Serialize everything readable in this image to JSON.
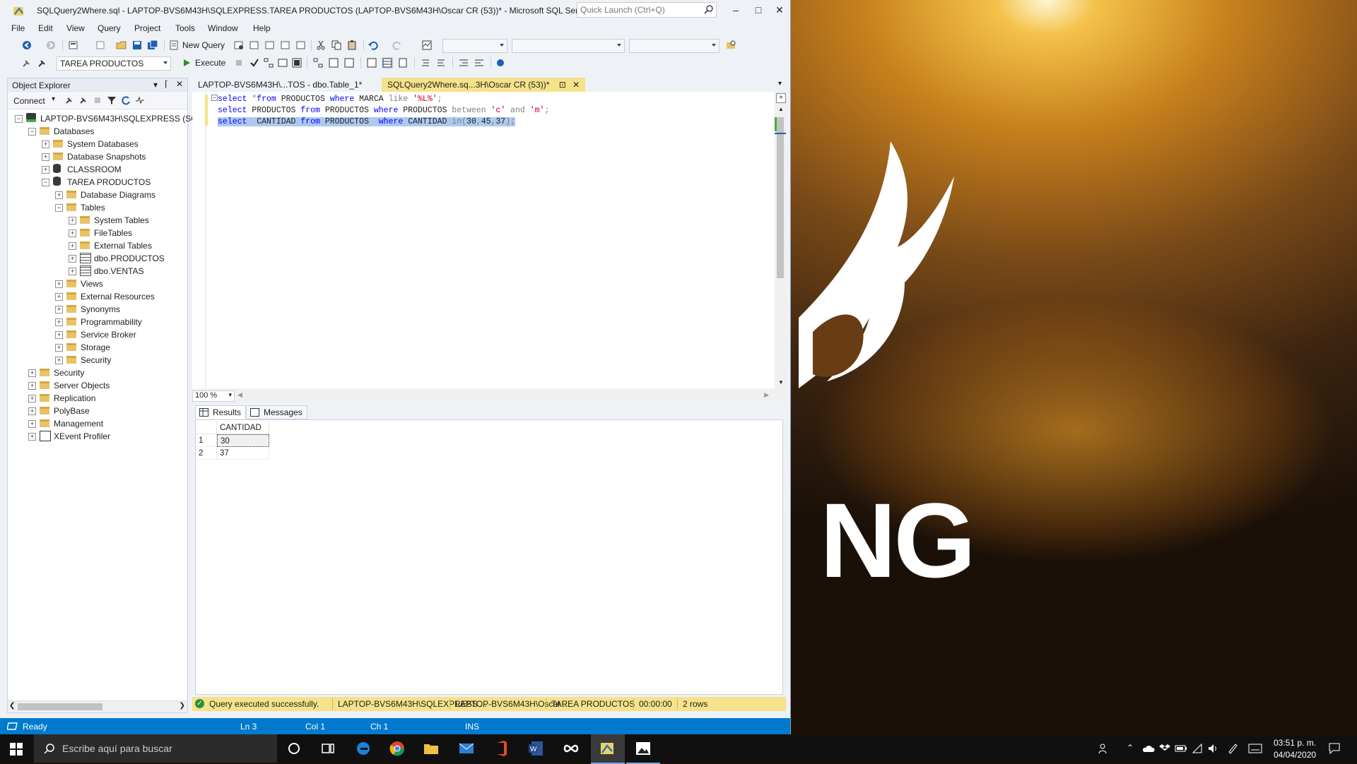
{
  "window": {
    "title": "SQLQuery2Where.sql - LAPTOP-BVS6M43H\\SQLEXPRESS.TAREA PRODUCTOS (LAPTOP-BVS6M43H\\Oscar CR (53))* - Microsoft SQL Server Man...",
    "quick_launch_placeholder": "Quick Launch (Ctrl+Q)"
  },
  "menu": [
    "File",
    "Edit",
    "View",
    "Query",
    "Project",
    "Tools",
    "Window",
    "Help"
  ],
  "toolbar": {
    "new_query": "New Query",
    "database_combo": "TAREA PRODUCTOS",
    "execute": "Execute"
  },
  "object_explorer": {
    "title": "Object Explorer",
    "connect": "Connect",
    "tree": [
      {
        "label": "LAPTOP-BVS6M43H\\SQLEXPRESS (SQL",
        "depth": 0,
        "expanded": true,
        "icon": "server-icon"
      },
      {
        "label": "Databases",
        "depth": 1,
        "expanded": true,
        "icon": "folder-icon"
      },
      {
        "label": "System Databases",
        "depth": 2,
        "expanded": false,
        "icon": "folder-icon"
      },
      {
        "label": "Database Snapshots",
        "depth": 2,
        "expanded": false,
        "icon": "folder-icon"
      },
      {
        "label": "CLASSROOM",
        "depth": 2,
        "expanded": false,
        "icon": "database-icon"
      },
      {
        "label": "TAREA PRODUCTOS",
        "depth": 2,
        "expanded": true,
        "icon": "database-icon"
      },
      {
        "label": "Database Diagrams",
        "depth": 3,
        "expanded": false,
        "icon": "folder-icon"
      },
      {
        "label": "Tables",
        "depth": 3,
        "expanded": true,
        "icon": "folder-icon"
      },
      {
        "label": "System Tables",
        "depth": 4,
        "expanded": false,
        "icon": "folder-icon"
      },
      {
        "label": "FileTables",
        "depth": 4,
        "expanded": false,
        "icon": "folder-icon"
      },
      {
        "label": "External Tables",
        "depth": 4,
        "expanded": false,
        "icon": "folder-icon"
      },
      {
        "label": "dbo.PRODUCTOS",
        "depth": 4,
        "expanded": false,
        "icon": "table-icon"
      },
      {
        "label": "dbo.VENTAS",
        "depth": 4,
        "expanded": false,
        "icon": "table-icon"
      },
      {
        "label": "Views",
        "depth": 3,
        "expanded": false,
        "icon": "folder-icon"
      },
      {
        "label": "External Resources",
        "depth": 3,
        "expanded": false,
        "icon": "folder-icon"
      },
      {
        "label": "Synonyms",
        "depth": 3,
        "expanded": false,
        "icon": "folder-icon"
      },
      {
        "label": "Programmability",
        "depth": 3,
        "expanded": false,
        "icon": "folder-icon"
      },
      {
        "label": "Service Broker",
        "depth": 3,
        "expanded": false,
        "icon": "folder-icon"
      },
      {
        "label": "Storage",
        "depth": 3,
        "expanded": false,
        "icon": "folder-icon"
      },
      {
        "label": "Security",
        "depth": 3,
        "expanded": false,
        "icon": "folder-icon"
      },
      {
        "label": "Security",
        "depth": 1,
        "expanded": false,
        "icon": "folder-icon"
      },
      {
        "label": "Server Objects",
        "depth": 1,
        "expanded": false,
        "icon": "folder-icon"
      },
      {
        "label": "Replication",
        "depth": 1,
        "expanded": false,
        "icon": "folder-icon"
      },
      {
        "label": "PolyBase",
        "depth": 1,
        "expanded": false,
        "icon": "folder-icon"
      },
      {
        "label": "Management",
        "depth": 1,
        "expanded": false,
        "icon": "folder-icon"
      },
      {
        "label": "XEvent Profiler",
        "depth": 1,
        "expanded": false,
        "icon": "profiler-icon"
      }
    ]
  },
  "doc_tabs": [
    {
      "label": "LAPTOP-BVS6M43H\\...TOS - dbo.Table_1*",
      "active": false
    },
    {
      "label": "SQLQuery2Where.sq...3H\\Oscar CR (53))*",
      "active": true
    }
  ],
  "editor": {
    "lines": [
      [
        {
          "t": "select ",
          "c": "kw"
        },
        {
          "t": "*",
          "c": "gr"
        },
        {
          "t": "from ",
          "c": "kw"
        },
        {
          "t": "PRODUCTOS ",
          "c": "idt"
        },
        {
          "t": "where ",
          "c": "kw"
        },
        {
          "t": "MARCA ",
          "c": "idt"
        },
        {
          "t": "like ",
          "c": "gr"
        },
        {
          "t": "'%L%'",
          "c": "str"
        },
        {
          "t": ";",
          "c": "gr"
        }
      ],
      [
        {
          "t": "select ",
          "c": "kw"
        },
        {
          "t": "PRODUCTOS ",
          "c": "idt"
        },
        {
          "t": "from ",
          "c": "kw"
        },
        {
          "t": "PRODUCTOS ",
          "c": "idt"
        },
        {
          "t": "where ",
          "c": "kw"
        },
        {
          "t": "PRODUCTOS ",
          "c": "idt"
        },
        {
          "t": "between ",
          "c": "gr"
        },
        {
          "t": "'c' ",
          "c": "str"
        },
        {
          "t": "and ",
          "c": "gr"
        },
        {
          "t": "'m'",
          "c": "str"
        },
        {
          "t": ";",
          "c": "gr"
        }
      ],
      [
        {
          "t": "select  ",
          "c": "kw"
        },
        {
          "t": "CANTIDAD ",
          "c": "idt"
        },
        {
          "t": "from ",
          "c": "kw"
        },
        {
          "t": "PRODUCTOS  ",
          "c": "idt"
        },
        {
          "t": "where ",
          "c": "kw"
        },
        {
          "t": "CANTIDAD ",
          "c": "idt"
        },
        {
          "t": "in",
          "c": "gr"
        },
        {
          "t": "(",
          "c": "gr"
        },
        {
          "t": "30",
          "c": "idt"
        },
        {
          "t": ",",
          "c": "gr"
        },
        {
          "t": "45",
          "c": "idt"
        },
        {
          "t": ",",
          "c": "gr"
        },
        {
          "t": "37",
          "c": "idt"
        },
        {
          "t": ");",
          "c": "gr"
        }
      ]
    ],
    "selected_line": 2,
    "zoom": "100 %"
  },
  "results": {
    "tab_results": "Results",
    "tab_messages": "Messages",
    "columns": [
      "CANTIDAD"
    ],
    "rows": [
      [
        "1",
        "30"
      ],
      [
        "2",
        "37"
      ]
    ]
  },
  "query_status": {
    "message": "Query executed successfully.",
    "server": "LAPTOP-BVS6M43H\\SQLEXPRESS ...",
    "user": "LAPTOP-BVS6M43H\\Oscar ...",
    "database": "TAREA PRODUCTOS",
    "time": "00:00:00",
    "rows": "2 rows"
  },
  "statusbar": {
    "ready": "Ready",
    "ln": "Ln 3",
    "col": "Col 1",
    "ch": "Ch 1",
    "ins": "INS"
  },
  "taskbar": {
    "search_placeholder": "Escribe aquí para buscar",
    "time": "03:51 p. m.",
    "date": "04/04/2020"
  },
  "desktop": {
    "wallpaper_text": "NG"
  },
  "colors": {
    "accent": "#007acc",
    "tab_active": "#f5e28a",
    "selection": "#adc9f0"
  }
}
